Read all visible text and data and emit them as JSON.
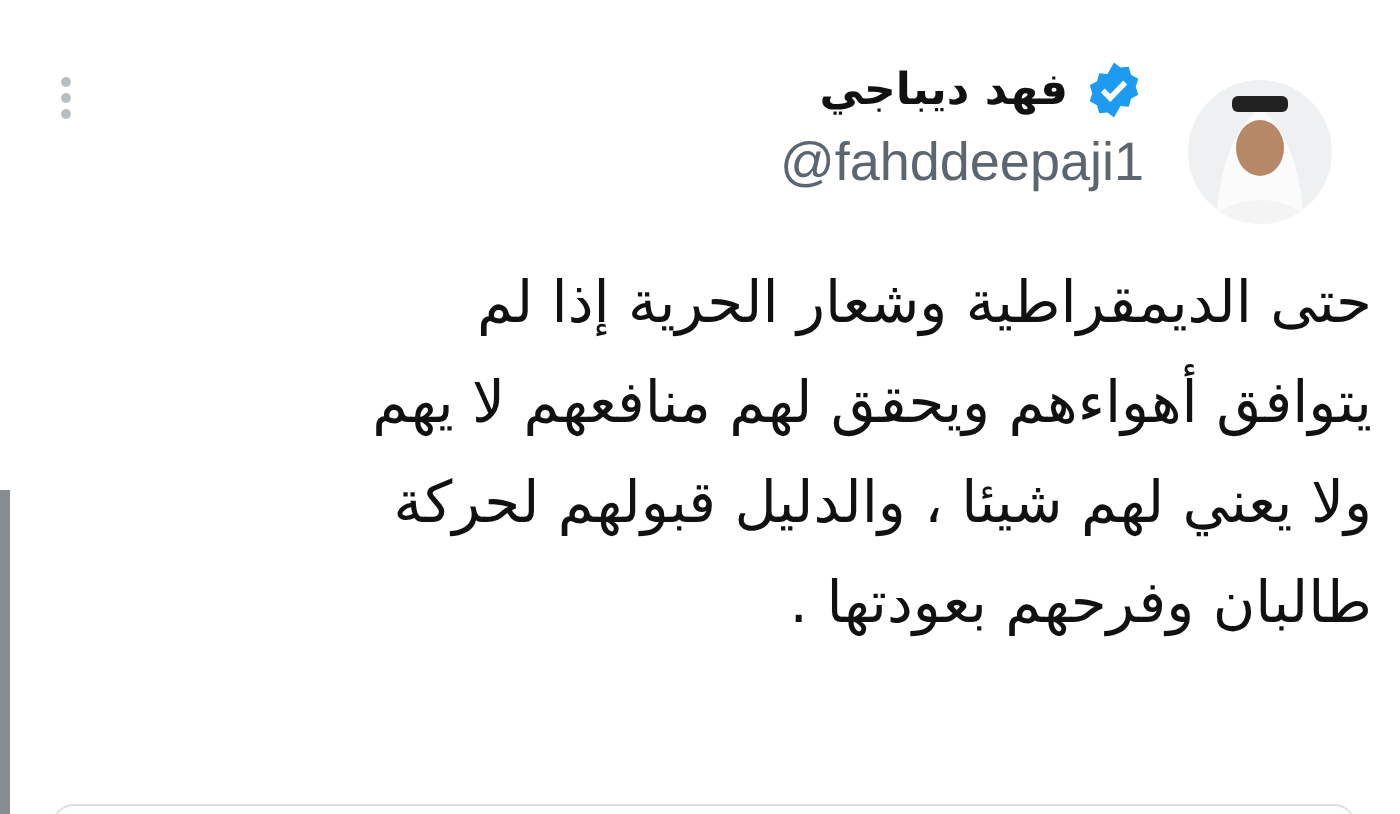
{
  "tweet": {
    "author_name": "فهد ديباجي",
    "verified": true,
    "handle": "@fahddeepaji1",
    "text_lines": [
      "حتى الديمقراطية وشعار الحرية  إذا لم",
      "يتوافق أهواءهم ويحقق لهم منافعهم لا يهم",
      "ولا يعني لهم شيئا ، والدليل قبولهم لحركة",
      "طالبان وفرحهم بعودتها ."
    ]
  }
}
